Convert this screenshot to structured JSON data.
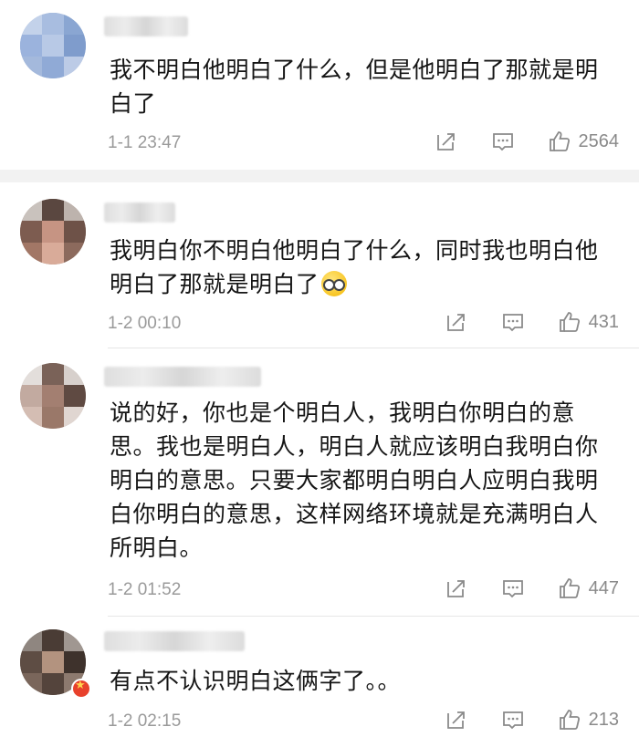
{
  "comments": [
    {
      "text": "我不明白他明白了什么，但是他明白了那就是明白了",
      "time": "1-1 23:47",
      "likes": "2564"
    },
    {
      "text": "我明白你不明白他明白了什么，同时我也明白他明白了那就是明白了",
      "time": "1-2 00:10",
      "likes": "431"
    },
    {
      "text": "说的好，你也是个明白人，我明白你明白的意思。我也是明白人，明白人就应该明白我明白你明白的意思。只要大家都明白明白人应明白我明白你明白的意思，这样网络环境就是充满明白人所明白。",
      "time": "1-2 01:52",
      "likes": "447"
    },
    {
      "text": "有点不认识明白这俩字了。。",
      "time": "1-2 02:15",
      "likes": "213"
    }
  ],
  "icons": {
    "share": "share-icon",
    "reply": "comment-icon",
    "like": "thumbs-up-icon"
  }
}
